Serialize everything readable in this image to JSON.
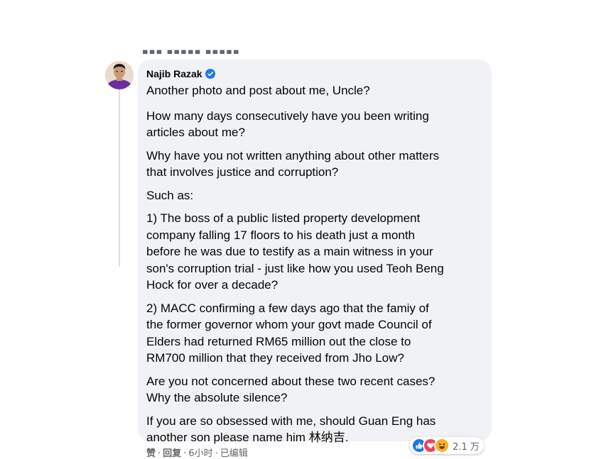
{
  "comment": {
    "author": "Najib Razak",
    "verified": true,
    "paragraphs": [
      "Another photo and post about me, Uncle?",
      "How many days consecutively have you been writing\narticles about me?",
      "Why have you not written anything about other matters\nthat involves justice and corruption?",
      "Such as:",
      "1) The boss of a public listed property development\ncompany falling 17 floors to his death just a month\nbefore he was due to testify as a main witness in your\nson's corruption trial - just like how you used Teoh Beng\nHock for over a decade?",
      "2) MACC confirming a few days ago that the famiy of\nthe former governor whom your govt made Council of\nElders had returned RM65 million out the close to\nRM700 million that they received from Jho Low?",
      "Are you not concerned about these two recent cases?\nWhy the absolute silence?",
      "If you are so obsessed with me, should Guan Eng has\nanother son please name him 林纳吉."
    ]
  },
  "footer": {
    "like": "赞",
    "reply": "回复",
    "time": "6小时",
    "edited": "已编辑",
    "separator": "·"
  },
  "reactions": {
    "icons": [
      "like-icon",
      "love-icon",
      "haha-icon"
    ],
    "count": "2.1 万"
  },
  "colors": {
    "bubble_bg": "#f0f2f5",
    "verified_blue": "#1877f2",
    "text": "#050505",
    "meta_text": "#65676b"
  }
}
